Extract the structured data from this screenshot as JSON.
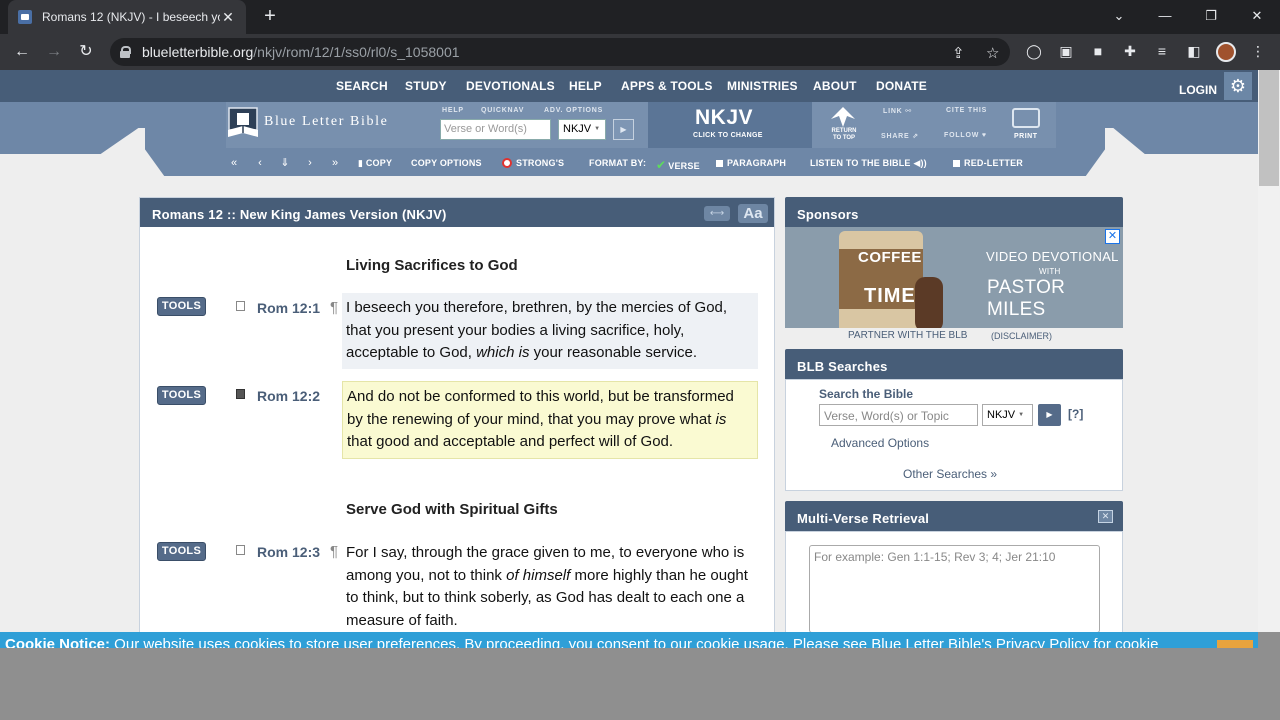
{
  "browser": {
    "tab_title": "Romans 12 (NKJV) - I beseech yo",
    "url_host": "blueletterbible.org",
    "url_path": "/nkjv/rom/12/1/ss0/rl0/s_1058001"
  },
  "topnav": {
    "items": [
      "SEARCH",
      "STUDY",
      "DEVOTIONALS",
      "HELP",
      "APPS & TOOLS",
      "MINISTRIES",
      "ABOUT",
      "DONATE"
    ],
    "login": "LOGIN"
  },
  "banner": {
    "logo": "Blue Letter Bible",
    "help_label": "HELP",
    "quicknav_label": "QUICKNAV",
    "adv_label": "ADV. OPTIONS",
    "quick_placeholder": "Verse or Word(s)",
    "quick_version": "NKJV",
    "version": "NKJV",
    "click_to_change": "CLICK TO CHANGE",
    "return_to_top": "RETURN TO TOP",
    "link": "LINK",
    "cite_this": "CITE THIS",
    "share": "SHARE",
    "follow": "FOLLOW",
    "print": "PRINT"
  },
  "subbar": {
    "copy": "COPY",
    "copy_options": "COPY OPTIONS",
    "strongs": "STRONG'S",
    "format_by": "FORMAT BY:",
    "verse": "VERSE",
    "paragraph": "PARAGRAPH",
    "listen": "LISTEN TO THE BIBLE",
    "red_letter": "RED-LETTER"
  },
  "panel": {
    "title": "Romans 12 :: New King James Version (NKJV)",
    "font_btn": "Aa",
    "tools_label": "TOOLS",
    "heading1": "Living Sacrifices to God",
    "heading2": "Serve God with Spiritual Gifts",
    "verses": [
      {
        "ref": "Rom 12:1",
        "pre": "I beseech you therefore, brethren, by the mercies of God, that you present your bodies a living sacrifice, holy, acceptable to God, ",
        "em": "which is",
        "post": " your reasonable service."
      },
      {
        "ref": "Rom 12:2",
        "pre": "And do not be conformed to this world, but be transformed by the renewing of your mind, that you may prove what ",
        "em": "is",
        "post": " that good and acceptable and perfect will of God."
      },
      {
        "ref": "Rom 12:3",
        "pre": "For I say, through the grace given to me, to everyone who is among you, not to think ",
        "em": "of himself",
        "post": " more highly than he ought to think, but to think soberly, as God has dealt to each one a measure of faith."
      }
    ]
  },
  "sponsors": {
    "title": "Sponsors",
    "ad_coffee": "COFFEE",
    "ad_time": "TIME",
    "ad_line1": "VIDEO DEVOTIONAL",
    "ad_line2": "WITH",
    "ad_line3": "PASTOR MILES",
    "partner": "PARTNER WITH THE BLB",
    "disclaimer": "(DISCLAIMER)"
  },
  "blb_searches": {
    "title": "BLB Searches",
    "search_label": "Search the Bible",
    "placeholder": "Verse, Word(s) or Topic",
    "version": "NKJV",
    "help": "[?]",
    "advanced": "Advanced Options",
    "other": "Other Searches"
  },
  "mvr": {
    "title": "Multi-Verse Retrieval",
    "placeholder": "For example: Gen 1:1-15; Rev 3; 4; Jer 21:10"
  },
  "cookie": {
    "label": "Cookie Notice:",
    "text": " Our website uses cookies to store user preferences. By proceeding, you consent to our cookie usage. Please see Blue Letter Bible's Privacy Policy for cookie"
  }
}
